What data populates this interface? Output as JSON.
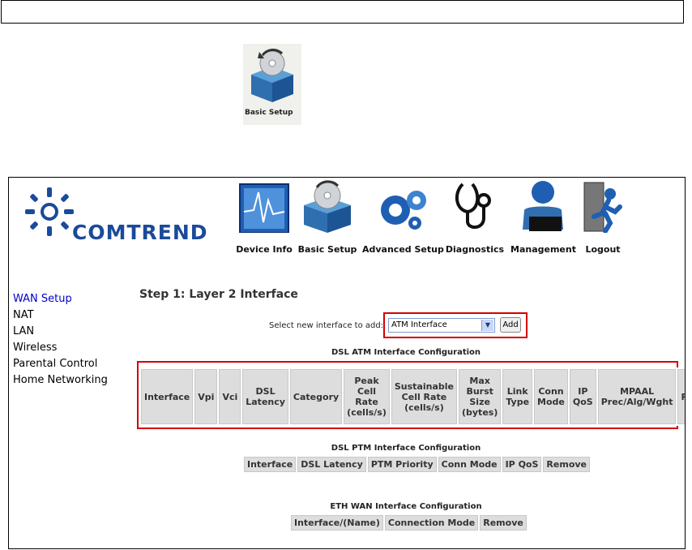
{
  "standalone_icon": {
    "label": "Basic Setup"
  },
  "brand": {
    "name": "COMTREND"
  },
  "nav": [
    {
      "label": "Device Info",
      "icon": "device-info-icon"
    },
    {
      "label": "Basic Setup",
      "icon": "basic-setup-icon"
    },
    {
      "label": "Advanced Setup",
      "icon": "advanced-setup-icon"
    },
    {
      "label": "Diagnostics",
      "icon": "diagnostics-icon"
    },
    {
      "label": "Management",
      "icon": "management-icon"
    },
    {
      "label": "Logout",
      "icon": "logout-icon"
    }
  ],
  "sidebar": {
    "items": [
      "WAN Setup",
      "NAT",
      "LAN",
      "Wireless",
      "Parental Control",
      "Home Networking"
    ]
  },
  "content": {
    "title": "Step 1: Layer 2 Interface",
    "select_label": "Select new interface to add:",
    "select_value": "ATM Interface",
    "add_label": "Add",
    "atm_caption": "DSL ATM Interface Configuration",
    "atm_headers": [
      "Interface",
      "Vpi",
      "Vci",
      "DSL Latency",
      "Category",
      "Peak Cell Rate (cells/s)",
      "Sustainable Cell Rate (cells/s)",
      "Max Burst Size (bytes)",
      "Link Type",
      "Conn Mode",
      "IP QoS",
      "MPAAL Prec/Alg/Wght",
      "Remove"
    ],
    "ptm_caption": "DSL PTM Interface Configuration",
    "ptm_headers": [
      "Interface",
      "DSL Latency",
      "PTM Priority",
      "Conn Mode",
      "IP QoS",
      "Remove"
    ],
    "eth_caption": "ETH WAN Interface Configuration",
    "eth_headers": [
      "Interface/(Name)",
      "Connection Mode",
      "Remove"
    ]
  },
  "colors": {
    "brand_blue": "#1a4a9a",
    "link_active": "#0000cc",
    "highlight_red": "#d40000",
    "header_cell": "#dddddd"
  }
}
